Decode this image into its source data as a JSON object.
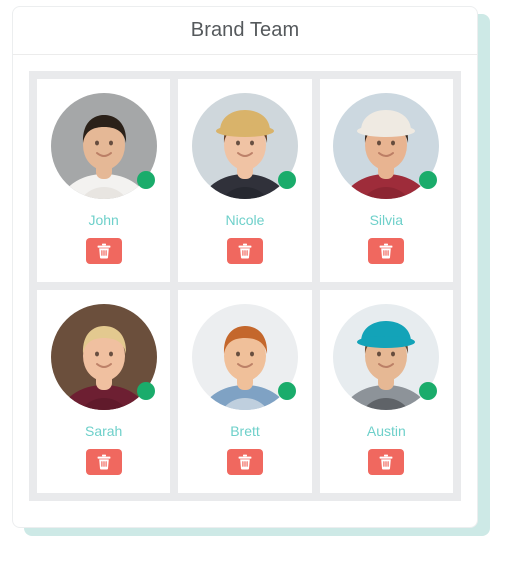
{
  "window": {
    "background_color": "#ffffff"
  },
  "panel": {
    "title": "Brand Team",
    "background_color": "#ffffff",
    "shadow_color": "#cde9e6",
    "border_color": "#eceeef",
    "grid_background_color": "#e9eaec"
  },
  "theme": {
    "title_color": "#55595c",
    "name_color": "#6ed0ca",
    "status_online_color": "#1aac6b",
    "delete_button_color": "#f0685f",
    "delete_icon_color": "#ffffff"
  },
  "icons": {
    "delete": "trash-icon",
    "status": "status-dot-icon"
  },
  "team": {
    "columns": 3,
    "members": [
      {
        "name": "John",
        "status": "online",
        "delete_label": "Delete John",
        "avatar": {
          "alt": "Smiling man with dark hair in a white shirt",
          "bg": "#a5a7a8",
          "skin": "#e5b896",
          "hair": "#2b2119",
          "clothes": "#f3f2f0",
          "clothes_shadow": "#dedbd6"
        }
      },
      {
        "name": "Nicole",
        "status": "online",
        "delete_label": "Delete Nicole",
        "avatar": {
          "alt": "Smiling woman wearing a straw sun hat",
          "bg": "#cfd7dc",
          "skin": "#f0c3a4",
          "hair": "#6a4228",
          "clothes": "#30313a",
          "clothes_shadow": "#1f2028",
          "hat": "#d9b36a"
        }
      },
      {
        "name": "Silvia",
        "status": "online",
        "delete_label": "Delete Silvia",
        "avatar": {
          "alt": "Woman in profile wearing a striped head wrap",
          "bg": "#ccd8e0",
          "skin": "#e8b491",
          "hair": "#3a2a20",
          "clothes": "#9e2c3a",
          "clothes_shadow": "#7d212c",
          "hat": "#efeae2"
        }
      },
      {
        "name": "Sarah",
        "status": "online",
        "delete_label": "Delete Sarah",
        "avatar": {
          "alt": "Laughing blonde woman in a maroon sweater",
          "bg": "#6b4f3c",
          "skin": "#f0c0a0",
          "hair": "#e3c98f",
          "clothes": "#6d1f32",
          "clothes_shadow": "#551626"
        }
      },
      {
        "name": "Brett",
        "status": "online",
        "delete_label": "Delete Brett",
        "avatar": {
          "alt": "Smiling red-haired bearded man in a denim jacket",
          "bg": "#eceef0",
          "skin": "#f0c09a",
          "hair": "#c4672c",
          "clothes": "#7fa2c4",
          "clothes_shadow": "#f4f4f4"
        }
      },
      {
        "name": "Austin",
        "status": "online",
        "delete_label": "Delete Austin",
        "avatar": {
          "alt": "Bearded man wearing a teal cap and grey tank top",
          "bg": "#e7ecef",
          "skin": "#e6b894",
          "hair": "#6b4a31",
          "clothes": "#8d9399",
          "clothes_shadow": "#3a3c40",
          "hat": "#13a3b8"
        }
      }
    ]
  }
}
